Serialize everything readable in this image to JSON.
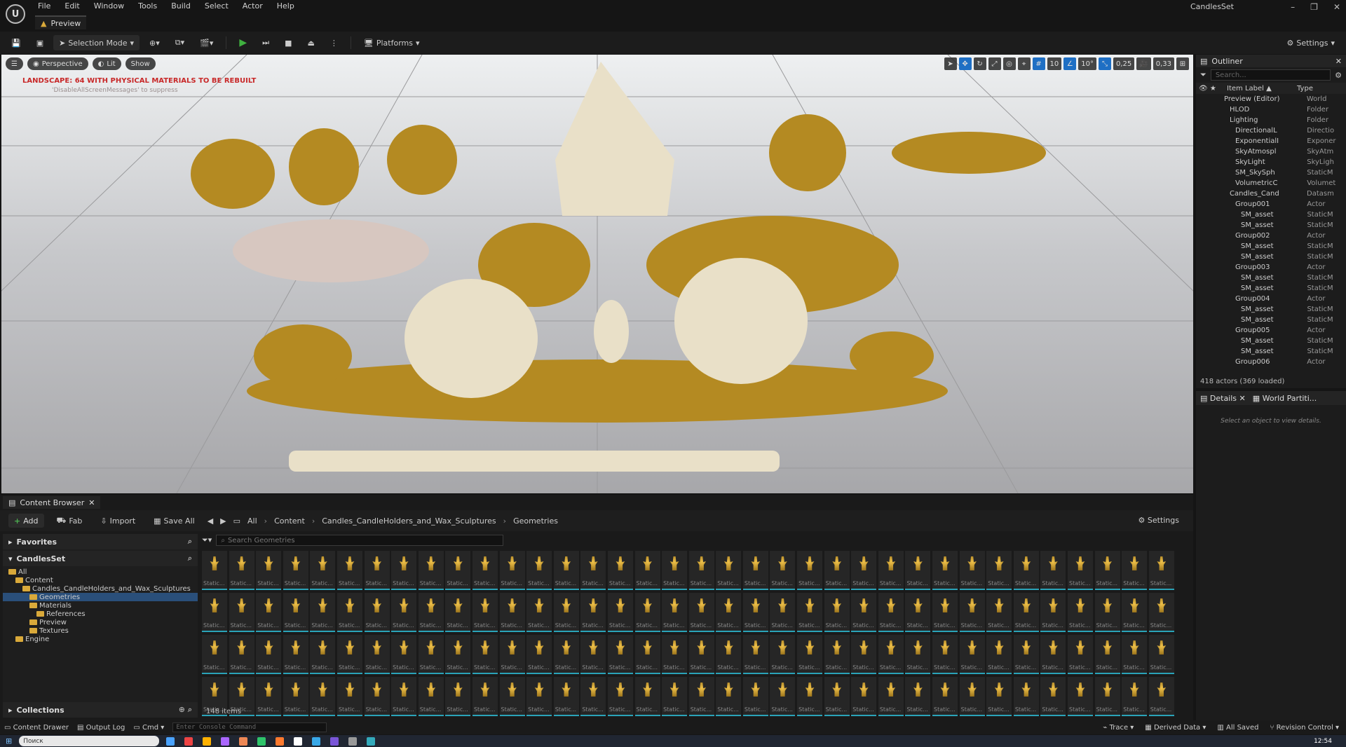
{
  "app": {
    "menu": [
      "File",
      "Edit",
      "Window",
      "Tools",
      "Build",
      "Select",
      "Actor",
      "Help"
    ],
    "project_title": "CandlesSet",
    "doc_tab": "Preview",
    "window_controls": [
      "–",
      "❐",
      "✕"
    ]
  },
  "toolbar": {
    "selection_mode": "Selection Mode",
    "platforms": "Platforms",
    "settings": "Settings"
  },
  "viewport": {
    "perspective": "Perspective",
    "lit": "Lit",
    "show": "Show",
    "grid_snap": "10",
    "rot_snap": "10°",
    "scale_snap": "0,25",
    "cam_speed": "0,33",
    "warning": "LANDSCAPE: 64  WITH PHYSICAL MATERIALS  TO BE REBUILT",
    "warning_sub": "'DisableAllScreenMessages' to suppress"
  },
  "content_browser": {
    "tab": "Content Browser",
    "add": "Add",
    "fab": "Fab",
    "import": "Import",
    "save_all": "Save All",
    "breadcrumb": [
      "All",
      "Content",
      "Candles_CandleHolders_and_Wax_Sculptures",
      "Geometries"
    ],
    "settings": "Settings",
    "favorites": "Favorites",
    "project": "CandlesSet",
    "tree": [
      {
        "label": "All",
        "indent": 0
      },
      {
        "label": "Content",
        "indent": 1
      },
      {
        "label": "Candles_CandleHolders_and_Wax_Sculptures",
        "indent": 2
      },
      {
        "label": "Geometries",
        "indent": 3,
        "selected": true
      },
      {
        "label": "Materials",
        "indent": 3
      },
      {
        "label": "References",
        "indent": 4
      },
      {
        "label": "Preview",
        "indent": 3
      },
      {
        "label": "Textures",
        "indent": 3
      },
      {
        "label": "Engine",
        "indent": 1
      }
    ],
    "search_placeholder": "Search Geometries",
    "tile_label": "Static...",
    "collections": "Collections",
    "item_count": "148 items"
  },
  "outliner": {
    "title": "Outliner",
    "search_placeholder": "Search...",
    "col_label": "Item Label ▲",
    "col_type": "Type",
    "rows": [
      {
        "name": "Preview (Editor)",
        "type": "World",
        "indent": 0
      },
      {
        "name": "HLOD",
        "type": "Folder",
        "indent": 1
      },
      {
        "name": "Lighting",
        "type": "Folder",
        "indent": 1
      },
      {
        "name": "DirectionalL",
        "type": "Directio",
        "indent": 2
      },
      {
        "name": "ExponentialI",
        "type": "Exponer",
        "indent": 2
      },
      {
        "name": "SkyAtmospl",
        "type": "SkyAtm",
        "indent": 2
      },
      {
        "name": "SkyLight",
        "type": "SkyLigh",
        "indent": 2
      },
      {
        "name": "SM_SkySph",
        "type": "StaticM",
        "indent": 2
      },
      {
        "name": "VolumetricC",
        "type": "Volumet",
        "indent": 2
      },
      {
        "name": "Candles_Cand",
        "type": "Datasm",
        "indent": 1
      },
      {
        "name": "Group001",
        "type": "Actor",
        "indent": 2
      },
      {
        "name": "SM_asset",
        "type": "StaticM",
        "indent": 3
      },
      {
        "name": "SM_asset",
        "type": "StaticM",
        "indent": 3
      },
      {
        "name": "Group002",
        "type": "Actor",
        "indent": 2
      },
      {
        "name": "SM_asset",
        "type": "StaticM",
        "indent": 3
      },
      {
        "name": "SM_asset",
        "type": "StaticM",
        "indent": 3
      },
      {
        "name": "Group003",
        "type": "Actor",
        "indent": 2
      },
      {
        "name": "SM_asset",
        "type": "StaticM",
        "indent": 3
      },
      {
        "name": "SM_asset",
        "type": "StaticM",
        "indent": 3
      },
      {
        "name": "Group004",
        "type": "Actor",
        "indent": 2
      },
      {
        "name": "SM_asset",
        "type": "StaticM",
        "indent": 3
      },
      {
        "name": "SM_asset",
        "type": "StaticM",
        "indent": 3
      },
      {
        "name": "Group005",
        "type": "Actor",
        "indent": 2
      },
      {
        "name": "SM_asset",
        "type": "StaticM",
        "indent": 3
      },
      {
        "name": "SM_asset",
        "type": "StaticM",
        "indent": 3
      },
      {
        "name": "Group006",
        "type": "Actor",
        "indent": 2
      }
    ],
    "footer": "418 actors (369 loaded)"
  },
  "details": {
    "tab1": "Details",
    "tab2": "World Partiti...",
    "empty": "Select an object to view details."
  },
  "status": {
    "content_drawer": "Content Drawer",
    "output_log": "Output Log",
    "cmd": "Cmd",
    "console_placeholder": "Enter Console Command",
    "trace": "Trace",
    "derived_data": "Derived Data",
    "all_saved": "All Saved",
    "revision_control": "Revision Control"
  },
  "taskbar": {
    "search": "Поиск",
    "time": "12:54"
  }
}
